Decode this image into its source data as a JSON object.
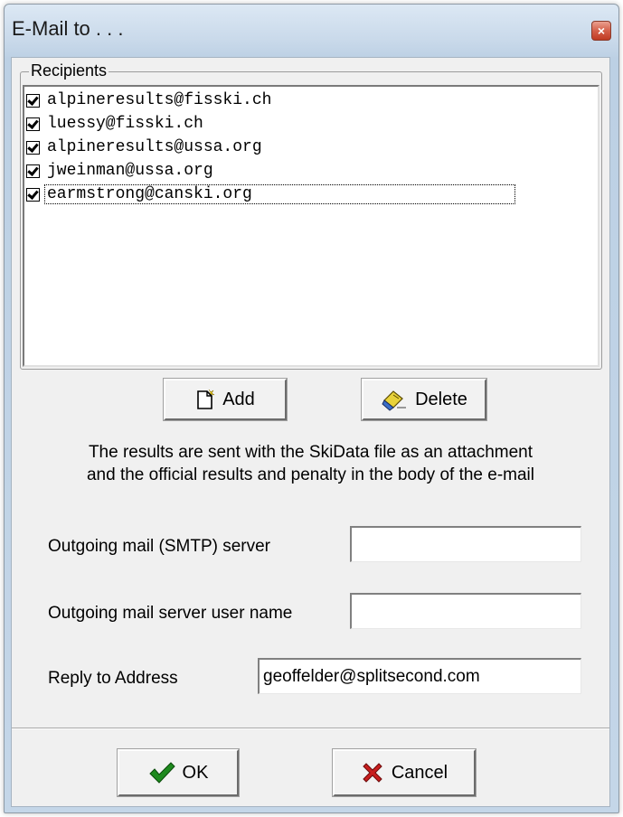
{
  "window": {
    "title": "E-Mail to . . .",
    "close_symbol": "×"
  },
  "recipients": {
    "group_label": "Recipients",
    "items": [
      {
        "address": "alpineresults@fisski.ch",
        "checked": true
      },
      {
        "address": "luessy@fisski.ch",
        "checked": true
      },
      {
        "address": "alpineresults@ussa.org",
        "checked": true
      },
      {
        "address": "jweinman@ussa.org",
        "checked": true
      },
      {
        "address": "earmstrong@canski.org",
        "checked": true,
        "focused": true
      }
    ]
  },
  "buttons": {
    "add_label": "Add",
    "add_icon": "new-document-icon",
    "delete_label": "Delete",
    "delete_icon": "eraser-icon",
    "ok_label": "OK",
    "ok_icon": "green-checkmark-icon",
    "cancel_label": "Cancel",
    "cancel_icon": "red-x-icon"
  },
  "info": {
    "line1": "The results are sent with the SkiData file as an attachment",
    "line2": "and the official results and penalty in the body of the e-mail"
  },
  "form": {
    "smtp_label": "Outgoing mail (SMTP) server",
    "smtp_value": "",
    "username_label": "Outgoing mail server user name",
    "username_value": "",
    "reply_label": "Reply to Address",
    "reply_value": "geoffelder@splitsecond.com"
  },
  "colors": {
    "ok_check": "#1e8a1e",
    "cancel_x": "#c81e1e",
    "close_button": "#c8432b"
  }
}
